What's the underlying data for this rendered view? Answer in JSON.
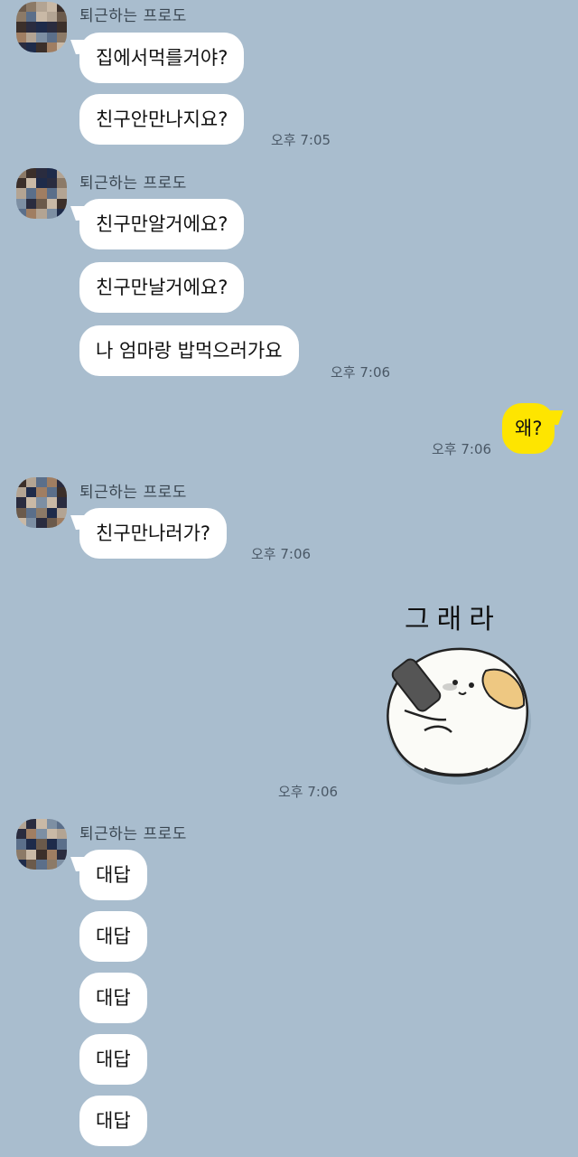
{
  "chat": {
    "sender": "퇴근하는 프로도",
    "groups": [
      {
        "messages": [
          "집에서먹를거야?",
          "친구안만나지요?"
        ],
        "time": "오후 7:05"
      },
      {
        "messages": [
          "친구만알거에요?",
          "친구만날거에요?",
          "나 엄마랑 밥먹으러가요"
        ],
        "time": "오후 7:06"
      },
      {
        "mine": "왜?",
        "time": "오후 7:06"
      },
      {
        "messages": [
          "친구만나러가?"
        ],
        "time": "오후 7:06"
      },
      {
        "sticker_caption": "그래라",
        "sticker_icon": "cat-with-phone-sticker",
        "time": "오후 7:06"
      },
      {
        "messages": [
          "대답",
          "대답",
          "대답",
          "대답",
          "대답"
        ]
      }
    ]
  },
  "colors": {
    "background": "#a9bdce",
    "bubble": "#ffffff",
    "my_bubble": "#fee500"
  }
}
